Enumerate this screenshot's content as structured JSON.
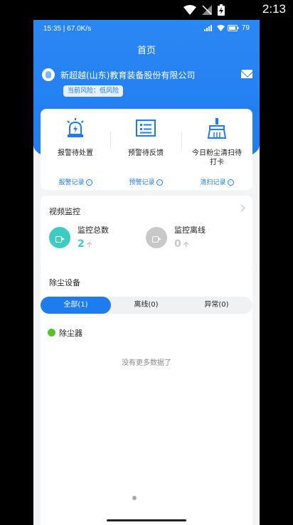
{
  "device_status": {
    "time": "2:13"
  },
  "phone_status": {
    "left_text": "15:35 | 67.0K/s",
    "battery": "79"
  },
  "nav": {
    "title": "首页"
  },
  "company": {
    "name": "新超越(山东)教育装备股份有限公司",
    "risk": "当前风险：低风险"
  },
  "alerts": [
    {
      "label": "报警待处置",
      "record": "报警记录"
    },
    {
      "label": "预警待反馈",
      "record": "预警记录"
    },
    {
      "label": "今日粉尘清扫待打卡",
      "record": "清扫记录"
    }
  ],
  "video": {
    "title": "视频监控",
    "total": {
      "label": "监控总数",
      "value": "2",
      "unit": "个",
      "color": "#3ecbc4"
    },
    "offline": {
      "label": "监控离线",
      "value": "0",
      "unit": "个",
      "color": "#c8c8c8"
    }
  },
  "dust": {
    "title": "除尘设备",
    "tabs": [
      "全部(1)",
      "离线(0)",
      "异常(0)"
    ],
    "device": "除尘器",
    "empty_text": "没有更多数据了"
  },
  "colors": {
    "primary": "#1f7cf0",
    "online": "#56c32b"
  }
}
